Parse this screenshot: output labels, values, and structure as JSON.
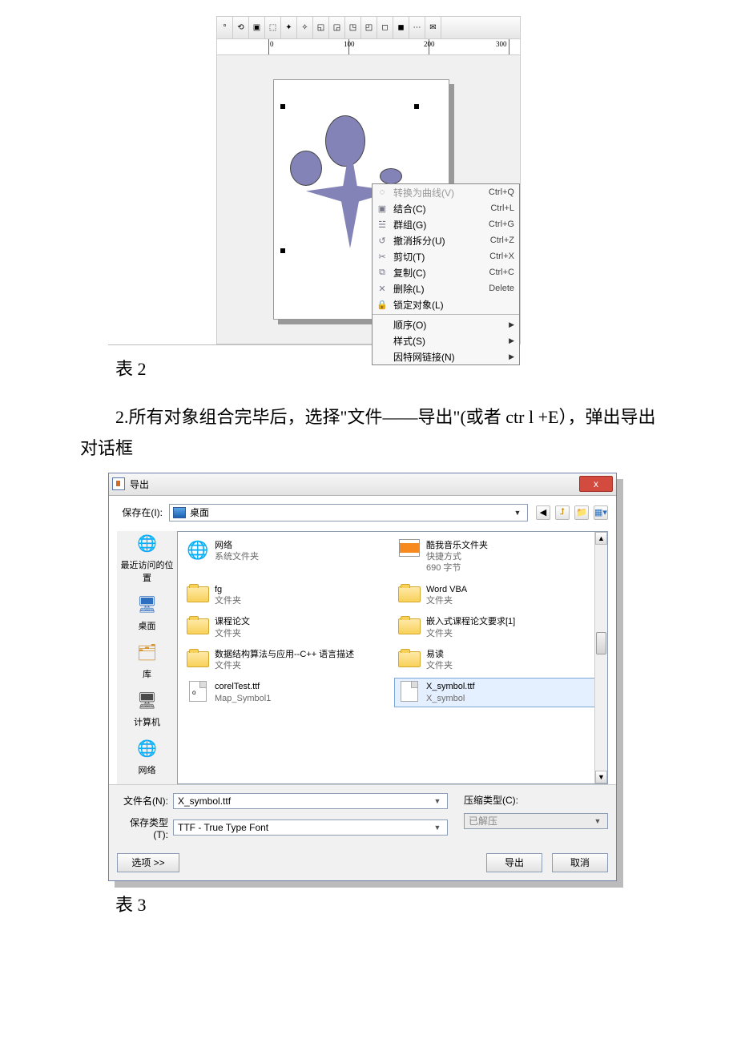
{
  "captions": {
    "fig2": "表 2",
    "para2": "2.所有对象组合完毕后，选择\"文件——导出\"(或者 ctr l +E），弹出导出对话框",
    "fig3": "表 3"
  },
  "ruler": {
    "marks": [
      "0",
      "100",
      "200",
      "300"
    ]
  },
  "context_menu": {
    "items": [
      {
        "icon": "◌",
        "label": "转换为曲线(V)",
        "shortcut": "Ctrl+Q",
        "disabled": true
      },
      {
        "icon": "▣",
        "label": "结合(C)",
        "shortcut": "Ctrl+L"
      },
      {
        "icon": "☱",
        "label": "群组(G)",
        "shortcut": "Ctrl+G"
      },
      {
        "icon": "↺",
        "label": "撤消拆分(U)",
        "shortcut": "Ctrl+Z"
      },
      {
        "icon": "✂",
        "label": "剪切(T)",
        "shortcut": "Ctrl+X"
      },
      {
        "icon": "⧉",
        "label": "复制(C)",
        "shortcut": "Ctrl+C"
      },
      {
        "icon": "✕",
        "label": "删除(L)",
        "shortcut": "Delete"
      },
      {
        "icon": "🔒",
        "label": "锁定对象(L)",
        "shortcut": ""
      }
    ],
    "subitems": [
      {
        "label": "顺序(O)"
      },
      {
        "label": "样式(S)"
      },
      {
        "label": "因特网链接(N)"
      }
    ]
  },
  "dialog": {
    "title": "导出",
    "close_txt": "x",
    "save_in_label": "保存在(I):",
    "save_in_value": "桌面",
    "places": [
      {
        "label": "最近访问的位置",
        "icon": "🌐"
      },
      {
        "label": "桌面",
        "icon": "🖥"
      },
      {
        "label": "库",
        "icon": "🗂"
      },
      {
        "label": "计算机",
        "icon": "🖥"
      },
      {
        "label": "网络",
        "icon": "🌐"
      }
    ],
    "files_left": [
      {
        "type": "sys",
        "name": "网络",
        "sub": "系统文件夹"
      },
      {
        "type": "folder",
        "name": "fg",
        "sub": "文件夹"
      },
      {
        "type": "folder",
        "name": "课程论文",
        "sub": "文件夹"
      },
      {
        "type": "folder",
        "name": "数据结构算法与应用--C++ 语言描述",
        "sub": "文件夹"
      },
      {
        "type": "ttf",
        "name": "corelTest.ttf",
        "sub": "Map_Symbol1"
      }
    ],
    "files_right": [
      {
        "type": "special",
        "name": "酷我音乐文件夹",
        "sub": "快捷方式",
        "sub2": "690 字节"
      },
      {
        "type": "folder",
        "name": "Word VBA",
        "sub": "文件夹"
      },
      {
        "type": "folder",
        "name": "嵌入式课程论文要求[1]",
        "sub": "文件夹"
      },
      {
        "type": "folder",
        "name": "易读",
        "sub": "文件夹"
      },
      {
        "type": "ttf",
        "name": "X_symbol.ttf",
        "sub": "X_symbol",
        "selected": true
      }
    ],
    "filename_label": "文件名(N):",
    "filename_value": "X_symbol.ttf",
    "savetype_label": "保存类型(T):",
    "savetype_value": "TTF - True Type Font",
    "comptype_label": "压缩类型(C):",
    "comptype_value": "已解压",
    "options_btn": "选项 >>",
    "export_btn": "导出",
    "cancel_btn": "取消"
  }
}
